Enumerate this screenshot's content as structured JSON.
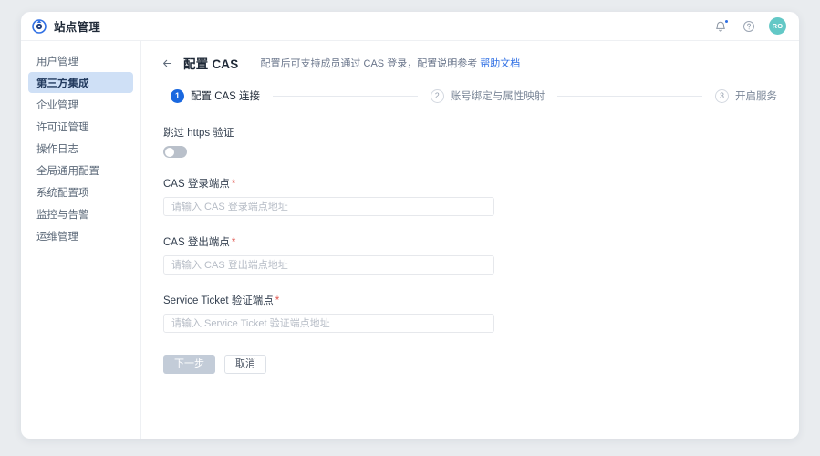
{
  "topbar": {
    "brand_title": "站点管理",
    "logo_icon": "circle-aperture-logo",
    "notification_icon": "bell-icon",
    "help_icon": "question-circle-icon",
    "avatar_initials": "RO",
    "avatar_color": "#63c8c6",
    "badge_color": "#2f6fe4"
  },
  "sidebar": {
    "items": [
      {
        "label": "用户管理",
        "active": false
      },
      {
        "label": "第三方集成",
        "active": true
      },
      {
        "label": "企业管理",
        "active": false
      },
      {
        "label": "许可证管理",
        "active": false
      },
      {
        "label": "操作日志",
        "active": false
      },
      {
        "label": "全局通用配置",
        "active": false
      },
      {
        "label": "系统配置项",
        "active": false
      },
      {
        "label": "监控与告警",
        "active": false
      },
      {
        "label": "运维管理",
        "active": false
      }
    ],
    "active_bg": "#cfe0f6"
  },
  "page": {
    "back_icon": "arrow-left-icon",
    "title": "配置 CAS",
    "subtitle_text": "配置后可支持成员通过 CAS 登录，配置说明参考",
    "subtitle_link": "帮助文档",
    "link_color": "#2f6fe4"
  },
  "stepper": {
    "steps": [
      {
        "num": "1",
        "label": "配置 CAS 连接",
        "state": "active"
      },
      {
        "num": "2",
        "label": "账号绑定与属性映射",
        "state": "idle"
      },
      {
        "num": "3",
        "label": "开启服务",
        "state": "idle"
      }
    ],
    "active_color": "#1a68df"
  },
  "form": {
    "toggle": {
      "label": "跳过 https 验证",
      "checked": false
    },
    "fields": [
      {
        "label": "CAS 登录端点",
        "required": "*",
        "value": "",
        "placeholder": "请输入 CAS 登录端点地址"
      },
      {
        "label": "CAS 登出端点",
        "required": "*",
        "value": "",
        "placeholder": "请输入 CAS 登出端点地址"
      },
      {
        "label": "Service Ticket 验证端点",
        "required": "*",
        "value": "",
        "placeholder": "请输入 Service Ticket 验证端点地址"
      }
    ],
    "actions": {
      "next_label": "下一步",
      "next_disabled": true,
      "cancel_label": "取消"
    }
  }
}
